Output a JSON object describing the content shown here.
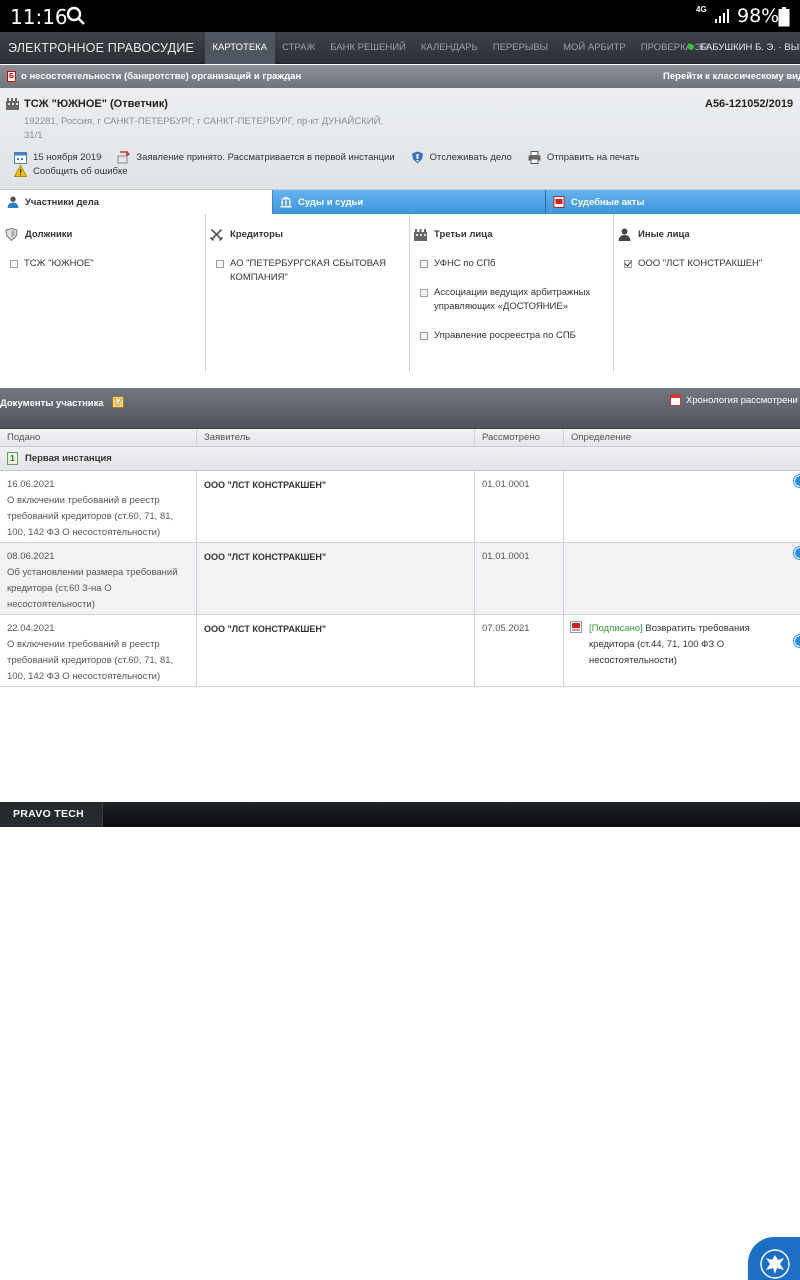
{
  "status_bar": {
    "time": "11:16",
    "network": "4G",
    "battery": "98%"
  },
  "nav": {
    "logo": "ЭЛЕКТРОННОЕ ПРАВОСУДИЕ",
    "items": [
      "КАРТОТЕКА",
      "СТРАЖ",
      "БАНК РЕШЕНИЙ",
      "КАЛЕНДАРЬ",
      "ПЕРЕРЫВЫ",
      "МОЙ АРБИТР",
      "ПРОВЕРКА ЭП"
    ],
    "active_index": 0,
    "user": "БАБУШКИН Б. Э. · ВЫЙТ"
  },
  "category": {
    "icon_letter": "Б",
    "text": "о несостоятельности (банкротстве) организаций и граждан",
    "classic_link": "Перейти к классическому вид"
  },
  "case": {
    "party": "ТСЖ \"ЮЖНОЕ\" (Ответчик)",
    "number": "А56-121052/2019",
    "address": "192281, Россия, г САНКТ-ПЕТЕРБУРГ, г САНКТ-ПЕТЕРБУРГ, пр-кт ДУНАЙСКИЙ, 31/1",
    "date": "15 ноября 2019",
    "status": "Заявление принято. Рассматривается в первой инстанции",
    "track": "Отслеживать дело",
    "print": "Отправить на печать",
    "report_error": "Сообщить об ошибке"
  },
  "tabs": [
    "Участники дела",
    "Суды и судьи",
    "Судебные акты"
  ],
  "participants": {
    "debtors": {
      "title": "Должники",
      "items": [
        {
          "name": "ТСЖ \"ЮЖНОЕ\"",
          "checked": false
        }
      ]
    },
    "creditors": {
      "title": "Кредиторы",
      "items": [
        {
          "name": "АО \"ПЕТЕРБУРГСКАЯ СБЫТОВАЯ КОМПАНИЯ\"",
          "checked": false
        }
      ]
    },
    "third": {
      "title": "Третьи лица",
      "items": [
        {
          "name": "УФНС по СПб",
          "checked": false
        },
        {
          "name": "Ассоциации ведущих арбитражных управляющих «ДОСТОЯНИЕ»",
          "checked": false
        },
        {
          "name": "Управление росреестра по СПБ",
          "checked": false
        }
      ]
    },
    "other": {
      "title": "Иные лица",
      "items": [
        {
          "name": "ООО \"ЛСТ КОНСТРАКШЕН\"",
          "checked": true
        }
      ]
    }
  },
  "documents": {
    "title": "Документы участника",
    "chronology": "Хронология рассмотрени",
    "headers": [
      "Подано",
      "Заявитель",
      "Рассмотрено",
      "Определение"
    ],
    "instance": "Первая инстанция",
    "instance_icon": "1",
    "rows": [
      {
        "date": "16.06.2021",
        "description": "О включении требований в реестр требований кредиторов (ст.60, 71, 81, 100, 142 ФЗ О несостоятельности)",
        "applicant": "ООО \"ЛСТ КОНСТРАКШЕН\"",
        "reviewed": "01.01.0001",
        "decision_status": "",
        "decision": ""
      },
      {
        "date": "08.06.2021",
        "description": "Об установлении размера требований кредитора (ст.60 З-на О несостоятельности)",
        "applicant": "ООО \"ЛСТ КОНСТРАКШЕН\"",
        "reviewed": "01.01.0001",
        "decision_status": "",
        "decision": ""
      },
      {
        "date": "22.04.2021",
        "description": "О включении требований в реестр требований кредиторов (ст.60, 71, 81, 100, 142 ФЗ О несостоятельности)",
        "applicant": "ООО \"ЛСТ КОНСТРАКШЕН\"",
        "reviewed": "07.05.2021",
        "decision_status": "[Подписано]",
        "decision": " Возвратить требования кредитора (ст.44, 71, 100 ФЗ О несостоятельности)"
      }
    ]
  },
  "footer": {
    "brand": "PRAVO TECH"
  },
  "colors": {
    "tab_blue": "#3c95d9",
    "signed_green": "#3a9a3a",
    "nav_dark": "#2c3036"
  }
}
